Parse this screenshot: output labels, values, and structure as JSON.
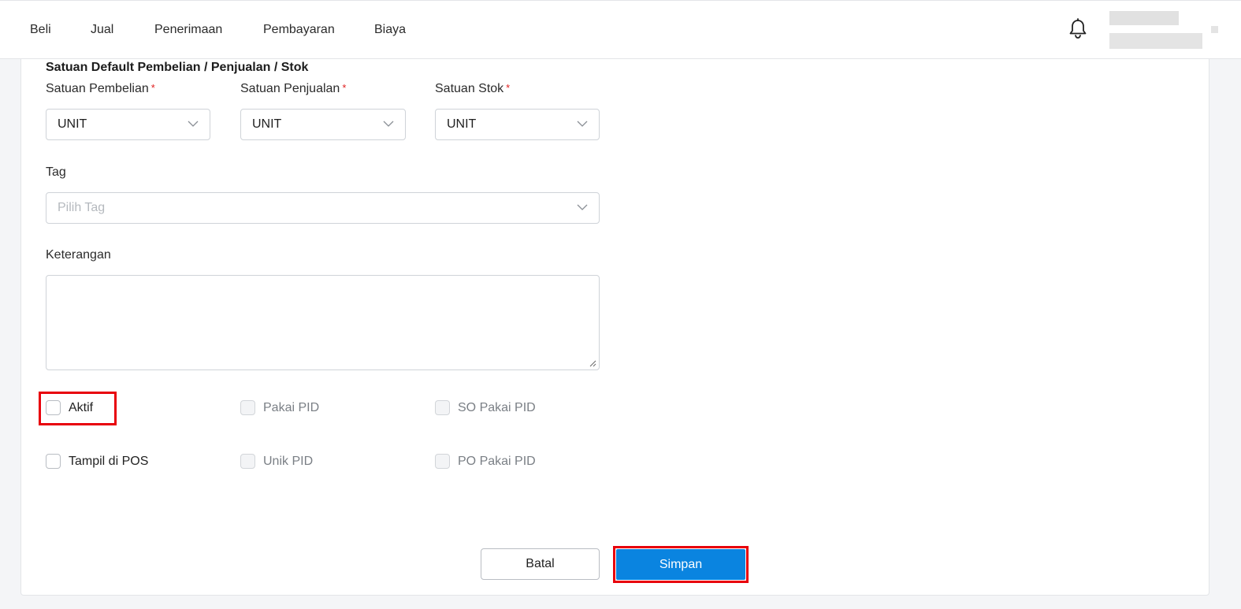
{
  "nav": {
    "items": [
      "Beli",
      "Jual",
      "Penerimaan",
      "Pembayaran",
      "Biaya"
    ]
  },
  "form": {
    "section_title": "Satuan Default Pembelian / Penjualan / Stok",
    "satuan_pembelian": {
      "label": "Satuan Pembelian",
      "value": "UNIT"
    },
    "satuan_penjualan": {
      "label": "Satuan Penjualan",
      "value": "UNIT"
    },
    "satuan_stok": {
      "label": "Satuan Stok",
      "value": "UNIT"
    },
    "required_mark": "*",
    "tag": {
      "label": "Tag",
      "placeholder": "Pilih Tag"
    },
    "keterangan": {
      "label": "Keterangan",
      "value": ""
    },
    "checkboxes": {
      "aktif": "Aktif",
      "pakai_pid": "Pakai PID",
      "so_pakai_pid": "SO Pakai PID",
      "tampil_di_pos": "Tampil di POS",
      "unik_pid": "Unik PID",
      "po_pakai_pid": "PO Pakai PID"
    }
  },
  "buttons": {
    "batal": "Batal",
    "simpan": "Simpan"
  },
  "colors": {
    "primary": "#0a84e0",
    "highlight": "#e8000b",
    "required": "#e02020"
  }
}
